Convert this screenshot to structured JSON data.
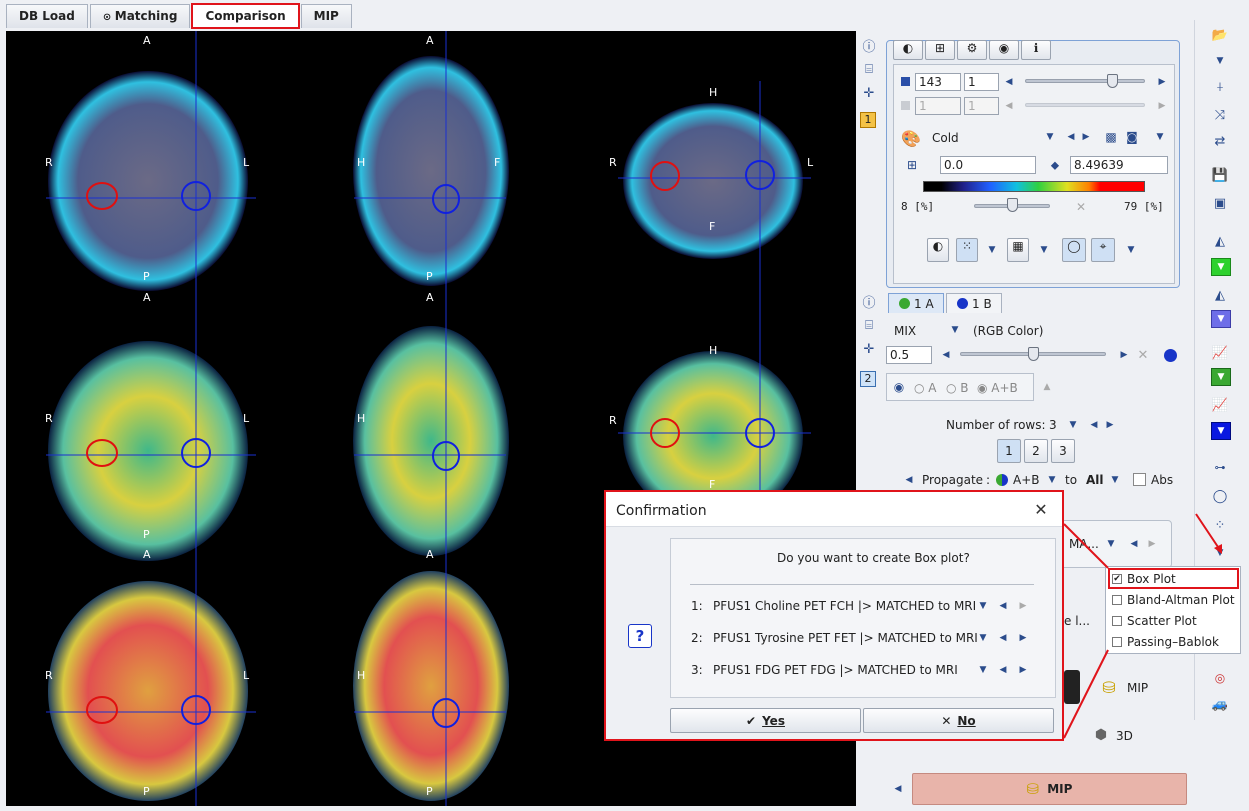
{
  "tabs": [
    "DB Load",
    "Matching",
    "Comparison",
    "MIP"
  ],
  "viewer": {
    "orient": {
      "a": "A",
      "p": "P",
      "r": "R",
      "l": "L",
      "h": "H",
      "f": "F"
    }
  },
  "side_index": {
    "one": "1",
    "two": "2"
  },
  "color_panel": {
    "value1": "143",
    "value2": "1",
    "value3": "1",
    "value4": "1",
    "colormap": "Cold",
    "min": "0.0",
    "max": "8.49639",
    "pct_low": "8 [%]",
    "pct_high": "79 [%]"
  },
  "mix_panel": {
    "tab_a": "1 A",
    "tab_b": "1 B",
    "mode": "MIX",
    "mode_desc": "(RGB Color)",
    "ratio": "0.5",
    "radio_a": "A",
    "radio_b": "B",
    "radio_ab": "A+B"
  },
  "layout": {
    "rows_label": "Number of rows:",
    "rows_value": "3",
    "row_buttons": [
      "1",
      "2",
      "3"
    ],
    "propagate_label": "Propagate",
    "propagate_value": "A+B",
    "to_label": "to",
    "to_value": "All",
    "abs_label": "Abs"
  },
  "hidden_partial": {
    "ma": "MA...",
    "le": "e l..."
  },
  "bottom": {
    "mip": "MIP",
    "d3": "3D",
    "mip_big": "MIP"
  },
  "dialog": {
    "title": "Confirmation",
    "question": "Do you want to create Box plot?",
    "help": "?",
    "items": [
      {
        "num": "1:",
        "text": "PFUS1 Choline PET FCH |> MATCHED to MRI"
      },
      {
        "num": "2:",
        "text": "PFUS1 Tyrosine PET FET |> MATCHED to MRI"
      },
      {
        "num": "3:",
        "text": "PFUS1 FDG PET FDG |> MATCHED to MRI"
      }
    ],
    "yes": "Yes",
    "no": "No"
  },
  "plot_menu": {
    "items": [
      "Box Plot",
      "Bland-Altman Plot",
      "Scatter Plot",
      "Passing–Bablok"
    ],
    "checked": 0
  },
  "colors": {
    "accent": "#e0141b",
    "roi_red": "#e01010",
    "roi_blue": "#1020e0",
    "cross": "#1a2fd0"
  }
}
